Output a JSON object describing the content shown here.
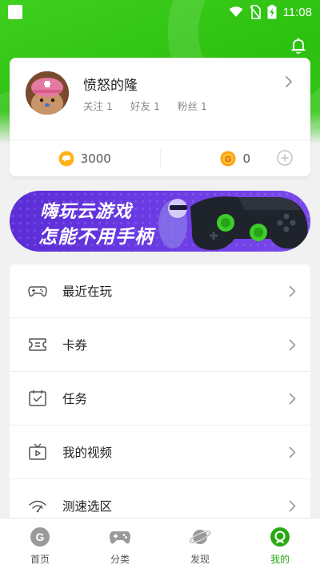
{
  "status_bar": {
    "time": "11:08"
  },
  "profile": {
    "username": "愤怒的隆",
    "follow_label": "关注",
    "follow_count": "1",
    "friends_label": "好友",
    "friends_count": "1",
    "fans_label": "粉丝",
    "fans_count": "1",
    "coins": "3000",
    "gcoins": "0"
  },
  "banner": {
    "line1": "嗨玩云游戏",
    "line2": "怎能不用手柄"
  },
  "menu": {
    "items": [
      {
        "label": "最近在玩",
        "icon": "gamepad-icon"
      },
      {
        "label": "卡券",
        "icon": "coupon-icon"
      },
      {
        "label": "任务",
        "icon": "task-icon"
      },
      {
        "label": "我的视频",
        "icon": "tv-icon"
      },
      {
        "label": "测速选区",
        "icon": "wifi-speed-icon"
      }
    ]
  },
  "nav": {
    "items": [
      {
        "label": "首页",
        "icon": "home-g-icon"
      },
      {
        "label": "分类",
        "icon": "gamepad-icon"
      },
      {
        "label": "发现",
        "icon": "planet-icon"
      },
      {
        "label": "我的",
        "icon": "profile-icon"
      }
    ],
    "active": "我的",
    "active_color": "#2aa816"
  },
  "colors": {
    "brand_green": "#2cc00f",
    "banner_purple": "#5b2dd6"
  }
}
